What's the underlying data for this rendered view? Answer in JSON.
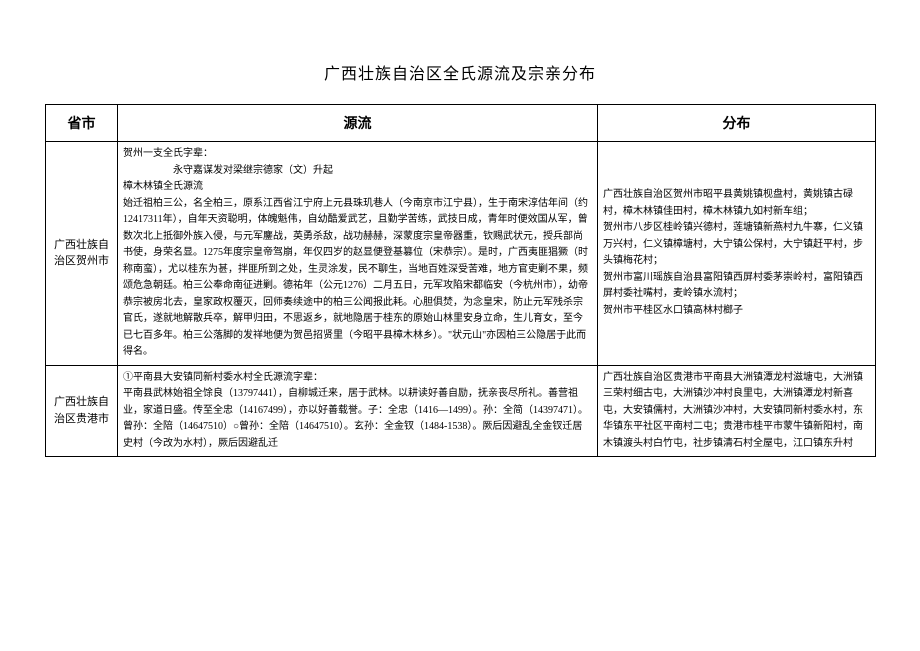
{
  "title": "广西壮族自治区全氏源流及宗亲分布",
  "headers": {
    "province": "省市",
    "origin": "源流",
    "distribution": "分布"
  },
  "rows": [
    {
      "province": "广西壮族自治区贺州市",
      "origin": "贺州一支全氏字辈：\n　　　　　永守嘉谋发对梁继宗德家（文）升起\n樟木林镇全氏源流\n始迁祖柏三公，名全柏三，原系江西省江宁府上元县珠玑巷人（今南京市江宁县），生于南宋淳估年间（约12417311年），自年天资聪明，体魄魁伟，自幼酷爱武艺，且勤学苦练，武技日成，青年时便效国从军，曾数次北上抵御外族入侵，与元军鏖战，英勇杀敌，战功赫赫，深蒙度宗皇帝器重，钦赐武状元，授兵部尚书使，身荣名显。1275年度宗皇帝驾崩，年仅四岁的赵显便登基篡位（宋恭宗）。是时，广西夷匪猖獗（时称南蛮），尤以桂东为甚，拌匪所到之处，生灵涂发，民不聊生，当地百姓深受苦难，地方官吏剿不果，频颂危急朝廷。柏三公奉命南征进剿。德祐年（公元1276）二月五日，元军攻陷宋都临安（今杭州市），幼帝恭宗被房北去，皇家政权覆灭，回师奏续途中的柏三公闻报此耗。心胆俱焚，为念皇宋，防止元军残杀宗官氏，遂就地解散兵卒，解甲归田，不思返乡，就地隐居于桂东的原始山林里安身立命，生儿育女，至今已七百多年。柏三公落脚的发祥地便为贺邑招贤里（今昭平县樟木林乡）。\"状元山\"亦因柏三公隐居于此而得名。",
      "distribution": "广西壮族自治区贺州市昭平县黄姚镇枧盘村，黄姚镇古碌村，樟木林镇佳田村，樟木林镇九如村新车组；\n贺州市八步区桂岭镇兴德村，莲塘镇新燕村九牛寨，仁义镇万兴村，仁义镇樟塘村，大宁镇公保村，大宁镇赶平村，步头镇梅花村；\n贺州市富川瑶族自治县富阳镇西屏村委茅崇岭村，富阳镇西屏村委社嘴村，麦岭镇水流村；\n贺州市平桂区水口镇高林村榔子"
    },
    {
      "province": "广西壮族自治区贵港市",
      "origin": "①平南县大安镇同新村委水村全氏源流字辈：\n平南县武林始祖全馀良（13797441），自柳城迁来，居于武林。以耕读好善自励，抚亲丧尽所礼。善营祖业，家道日盛。传至全忠（14167499），亦以好善载誉。子：全忠（1416—1499）。孙：全简（14397471）。\n曾孙：全陪（14647510）○曾孙：全陪（14647510）。玄孙：全金钗（1484-1538）。厥后因避乱全金钗迁居史村（今改为水村），厥后因避乱迁",
      "distribution": "广西壮族自治区贵港市平南县大洲镇潭龙村滋塘屯，大洲镇三荣村细古屯，大洲镇沙冲村良里屯，大洲镇潭龙村新喜屯，大安镇儒村，大洲镇沙冲村，大安镇同新村委水村，东华镇东平社区平南村二屯；贵港市桂平市蒙牛镇新阳村，南木镇渡头村白竹屯，社步镇清石村全屋屯，江口镇东升村"
    }
  ]
}
